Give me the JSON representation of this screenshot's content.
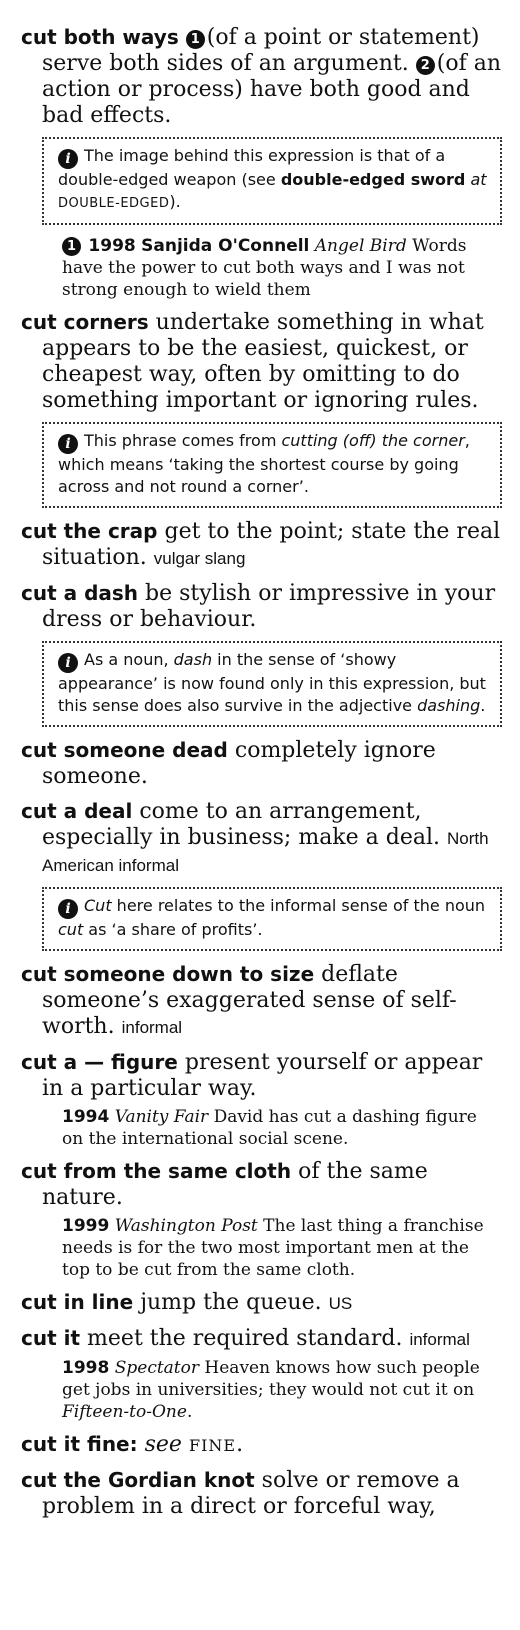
{
  "entries": [
    {
      "headword": "cut both ways",
      "sense1_num": "1",
      "sense1": "(of a point or statement) serve both sides of an argument.",
      "sense2_num": "2",
      "sense2": "(of an action or process) have both good and bad effects.",
      "note": {
        "icon": "info-icon",
        "text1": "The image behind this expression is that of a double-edged weapon (see ",
        "bold": "double-edged sword",
        "at": " at ",
        "xref": "DOUBLE-EDGED",
        "text2": ")."
      },
      "quote": {
        "num": "1",
        "year": "1998",
        "author": "Sanjida O'Connell",
        "source": "Angel Bird",
        "text": "Words have the power to cut both ways and I was not strong enough to wield them"
      }
    },
    {
      "headword": "cut corners",
      "def": "undertake something in what appears to be the easiest, quickest, or cheapest way, often by omitting to do something important or ignoring rules.",
      "note": {
        "text1": "This phrase comes from ",
        "ital": "cutting (off) the corner",
        "text2": ", which means ‘taking the shortest course by going across and not round a corner’."
      }
    },
    {
      "headword": "cut the crap",
      "def": "get to the point; state the real situation.",
      "register": "vulgar slang"
    },
    {
      "headword": "cut a dash",
      "def": "be stylish or impressive in your dress or behaviour.",
      "note": {
        "text1": "As a noun, ",
        "ital": "dash",
        "text2": " in the sense of ‘showy appearance’ is now found only in this expression, but this sense does also survive in the adjective ",
        "ital2": "dashing",
        "text3": "."
      }
    },
    {
      "headword": "cut someone dead",
      "def": "completely ignore someone."
    },
    {
      "headword": "cut a deal",
      "def": "come to an arrangement, especially in business; make a deal.",
      "register": "North American informal",
      "note": {
        "ital": "Cut",
        "text1": " here relates to the informal sense of the noun ",
        "ital2": "cut",
        "text2": " as ‘a share of profits’."
      }
    },
    {
      "headword": "cut someone down to size",
      "def": "deflate someone’s exaggerated sense of self-worth.",
      "register": "informal"
    },
    {
      "headword": "cut a — figure",
      "def": "present yourself or appear in a particular way.",
      "quote": {
        "year": "1994",
        "source": "Vanity Fair",
        "text": "David has cut a dashing figure on the international social scene."
      }
    },
    {
      "headword": "cut from the same cloth",
      "def": "of the same nature.",
      "quote": {
        "year": "1999",
        "source": "Washington Post",
        "text": "The last thing a franchise needs is for the two most important men at the top to be cut from the same cloth."
      }
    },
    {
      "headword": "cut in line",
      "def": "jump the queue.",
      "register": "US"
    },
    {
      "headword": "cut it",
      "def": "meet the required standard.",
      "register": "informal",
      "quote": {
        "year": "1998",
        "source": "Spectator",
        "text": "Heaven knows how such people get jobs in universities; they would not cut it on ",
        "ital": "Fifteen-to-One",
        "end": "."
      }
    },
    {
      "headword": "cut it fine",
      "colon": ":",
      "see": "see",
      "xref": "FINE",
      "end": "."
    },
    {
      "headword": "cut the Gordian knot",
      "def": "solve or remove a problem in a direct or forceful way,"
    }
  ]
}
